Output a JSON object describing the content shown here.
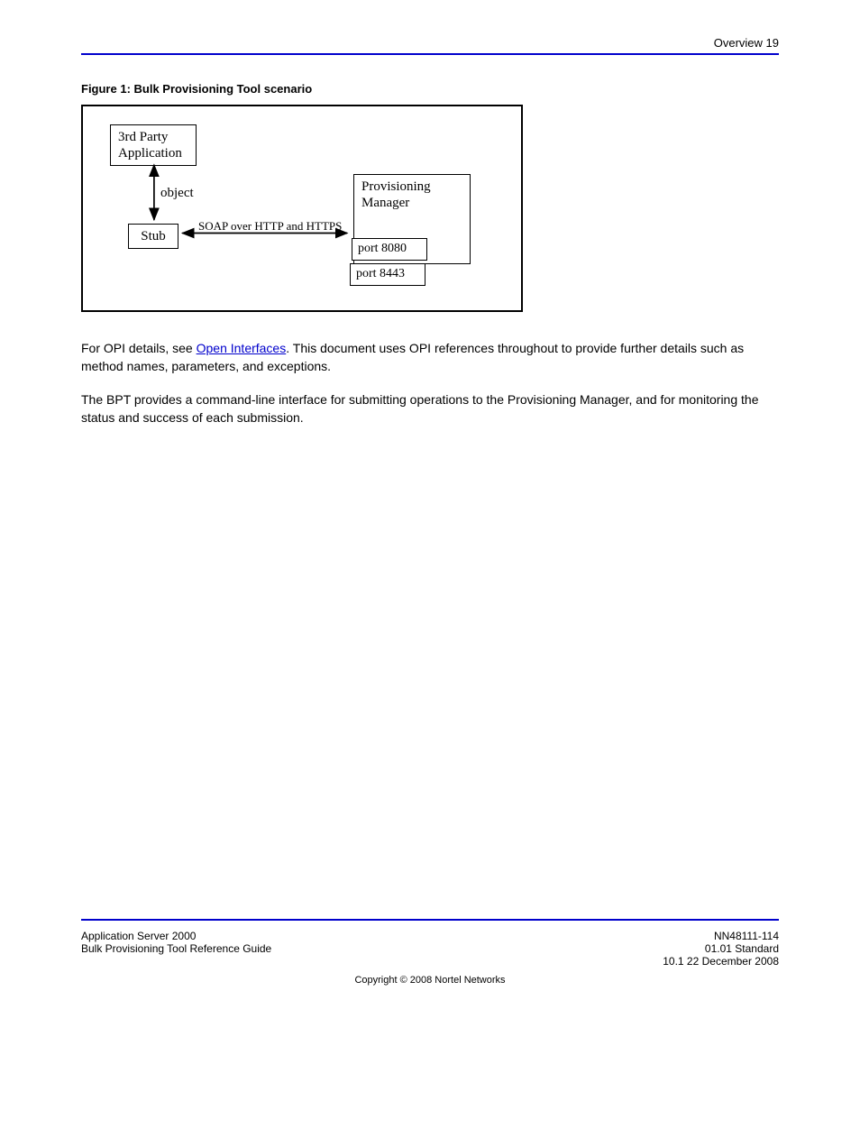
{
  "header": {
    "right": "Overview  19"
  },
  "figure": {
    "label": "Figure 1: Bulk Provisioning Tool scenario",
    "box_third_party_l1": "3rd Party",
    "box_third_party_l2": "Application",
    "label_object": "object",
    "box_stub": "Stub",
    "label_soap": "SOAP over HTTP and HTTPS",
    "box_provmgr_l1": "Provisioning",
    "box_provmgr_l2": "Manager",
    "box_port1": "port 8080",
    "box_port2": "port 8443"
  },
  "paragraphs": {
    "p1_a": "For OPI details, see ",
    "p1_link": "Open Interfaces",
    "p1_b": ". This document uses OPI references throughout to provide further details such as method names, parameters, and exceptions.",
    "p2": "The BPT provides a command-line interface for submitting operations to the Provisioning Manager, and for monitoring the status and success of each submission."
  },
  "footer": {
    "left_l1": "Application Server 2000",
    "left_l2": "Bulk Provisioning Tool Reference Guide",
    "right_l1": "NN48111-114",
    "right_l2": "01.01 Standard",
    "right_l3": "10.1 22 December 2008",
    "copyright": "Copyright © 2008 Nortel Networks"
  }
}
